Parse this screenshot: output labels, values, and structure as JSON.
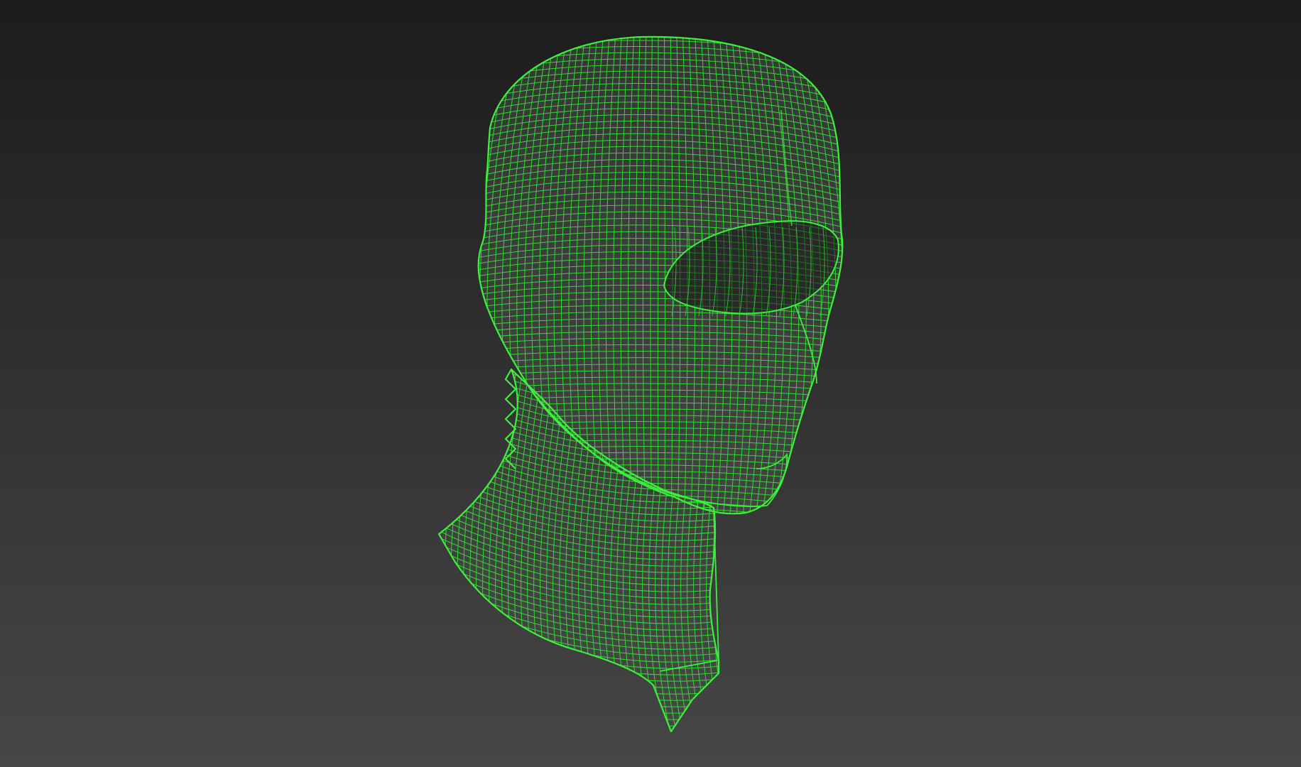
{
  "viewport": {
    "background_top": "#1c1c1c",
    "background_bottom": "#464646"
  },
  "model": {
    "wire_color": "#2fdc2f",
    "edge_color": "#3cf03c",
    "shading_color": "#4a4a4a",
    "hole_color": "#1a1a1a",
    "icon": "wireframe-head-balaclava-mesh"
  }
}
